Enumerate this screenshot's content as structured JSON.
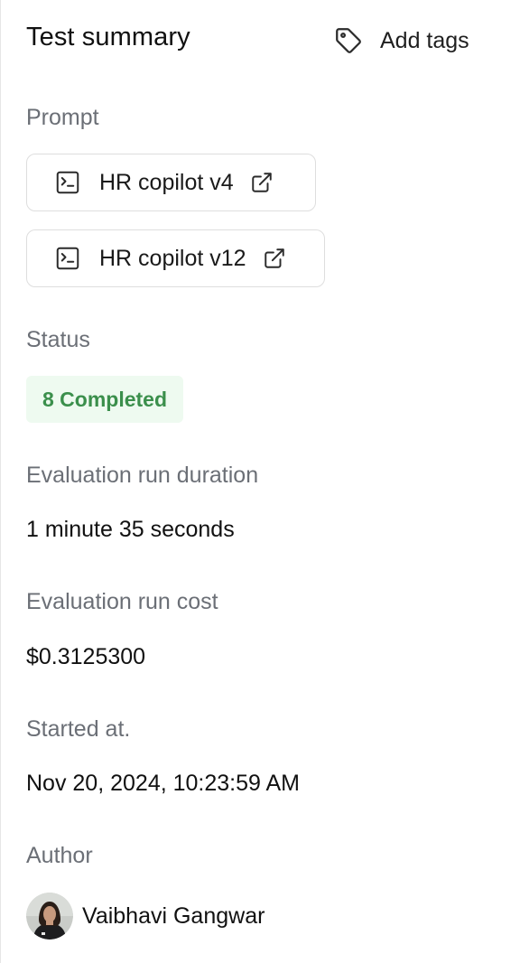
{
  "header": {
    "title": "Test summary",
    "add_tags_label": "Add tags",
    "add_tags_icon": "tag-icon"
  },
  "prompt": {
    "label": "Prompt",
    "items": [
      {
        "label": "HR copilot v4",
        "icon": "terminal-icon",
        "link_icon": "external-link-icon"
      },
      {
        "label": "HR copilot v12",
        "icon": "terminal-icon",
        "link_icon": "external-link-icon"
      }
    ]
  },
  "status": {
    "label": "Status",
    "badge": "8 Completed",
    "badge_color": "#3b8f4c",
    "badge_bg": "#eefaf0"
  },
  "duration": {
    "label": "Evaluation run duration",
    "value": "1 minute 35 seconds"
  },
  "cost": {
    "label": "Evaluation run cost",
    "value": "$0.3125300"
  },
  "started": {
    "label": "Started at.",
    "value": "Nov 20, 2024, 10:23:59 AM"
  },
  "author": {
    "label": "Author",
    "name": "Vaibhavi Gangwar",
    "avatar": "avatar-photo"
  }
}
